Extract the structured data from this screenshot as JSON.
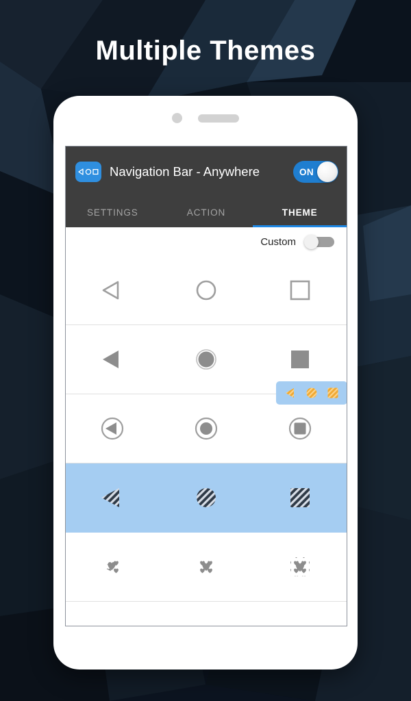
{
  "headline": {
    "text": "Multiple Themes"
  },
  "phone": {
    "camera_icon": "camera-dot-icon",
    "speaker_icon": "speaker-grille-icon"
  },
  "appbar": {
    "icon": "navigation-bar-app-icon",
    "title": "Navigation Bar - Anywhere",
    "toggle": {
      "label": "ON",
      "state": "on",
      "color": "#1f7ed0"
    }
  },
  "tabs": {
    "items": [
      {
        "label": "SETTINGS",
        "active": false
      },
      {
        "label": "ACTION",
        "active": false
      },
      {
        "label": "THEME",
        "active": true
      }
    ],
    "indicator_color": "#1e88e5",
    "bar_color": "#3e3e3e"
  },
  "custom": {
    "label": "Custom",
    "toggle_state": "off"
  },
  "theme_list": {
    "selected_index": 3,
    "selection_color": "#a5cdf2",
    "icon_color": "#9e9e9e",
    "rows": [
      {
        "style": "outline",
        "icons": [
          "back-triangle-outline-icon",
          "home-circle-outline-icon",
          "recents-square-outline-icon"
        ],
        "selected": false
      },
      {
        "style": "solid",
        "icons": [
          "back-triangle-solid-icon",
          "home-circle-solid-icon",
          "recents-square-solid-icon"
        ],
        "selected": false
      },
      {
        "style": "circled",
        "icons": [
          "back-triangle-circled-icon",
          "home-circle-circled-icon",
          "recents-square-circled-icon"
        ],
        "selected": false
      },
      {
        "style": "hatched",
        "icons": [
          "back-triangle-hatched-icon",
          "home-circle-hatched-icon",
          "recents-square-hatched-icon"
        ],
        "selected": true
      },
      {
        "style": "hearts",
        "icons": [
          "back-triangle-hearts-icon",
          "home-circle-hearts-icon",
          "recents-square-hearts-icon"
        ],
        "selected": false
      },
      {
        "style": "stars-outline",
        "icons": [
          "back-triangle-star-outline-icon",
          "home-circle-star-outline-icon",
          "recents-square-star-outline-icon"
        ],
        "selected": false
      }
    ]
  },
  "preview_popup": {
    "background": "#a5cdf2",
    "icon_color": "#f5a623",
    "icons": [
      "preview-back-triangle-icon",
      "preview-home-circle-icon",
      "preview-recents-square-icon"
    ]
  }
}
